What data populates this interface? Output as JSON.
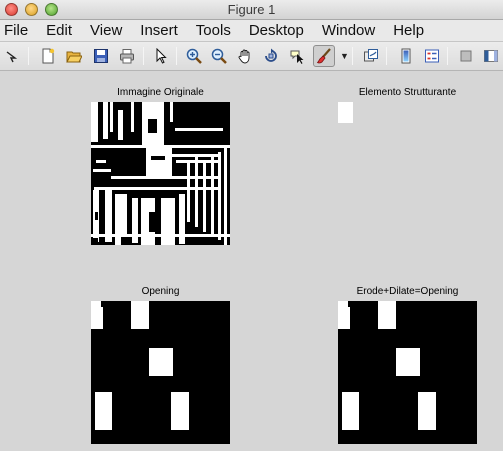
{
  "window": {
    "title": "Figure 1"
  },
  "menu": [
    "File",
    "Edit",
    "View",
    "Insert",
    "Tools",
    "Desktop",
    "Window",
    "Help"
  ],
  "toolbar": {
    "icons": [
      "arrow-icon",
      "new-figure-icon",
      "open-file-icon",
      "save-icon",
      "print-icon",
      "edit-plot-icon",
      "zoom-in-icon",
      "zoom-out-icon",
      "pan-icon",
      "rotate-3d-icon",
      "data-cursor-icon",
      "brush-icon",
      "brush-dropdown-icon",
      "link-plot-icon",
      "colorbar-icon",
      "legend-icon",
      "hide-plot-tools-icon",
      "show-plot-tools-icon"
    ]
  },
  "axes": {
    "original": {
      "title": "Immagine Originale"
    },
    "structuring_element": {
      "title": "Elemento Strutturante"
    },
    "opening": {
      "title": "Opening"
    },
    "erode_dilate": {
      "title": "Erode+Dilate=Opening"
    }
  },
  "colors": {
    "figure_bg": "#d6d6d6",
    "image_black": "#000000",
    "image_white": "#ffffff"
  }
}
